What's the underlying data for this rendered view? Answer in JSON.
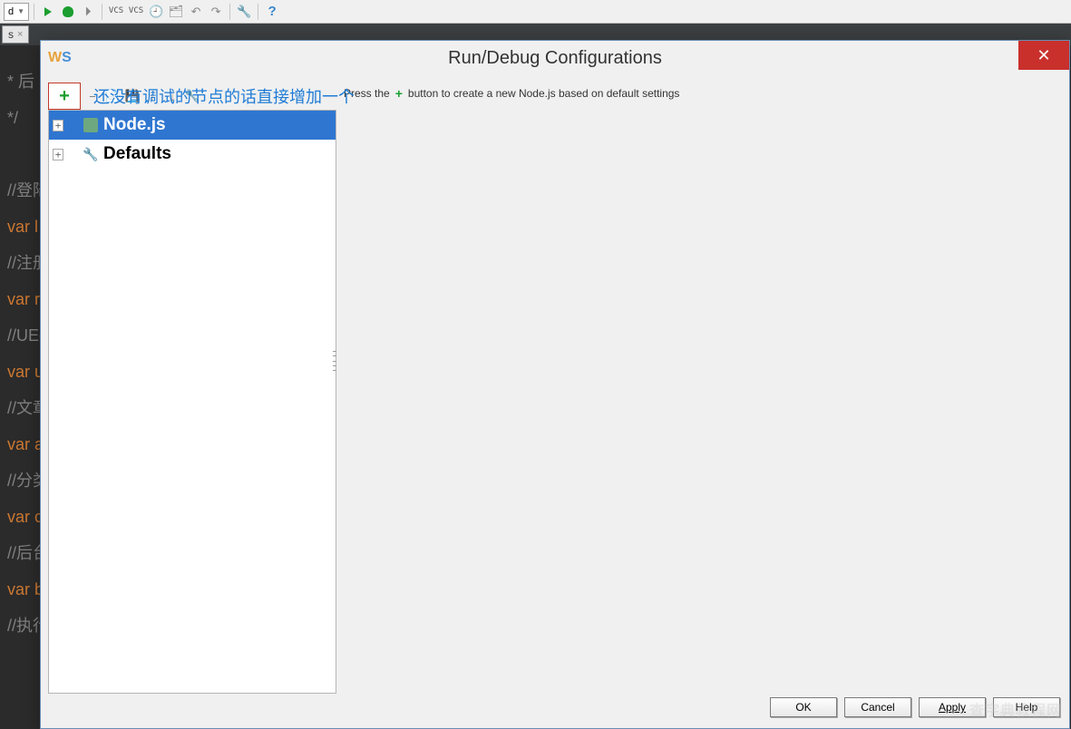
{
  "toolbar": {
    "run_config_label": "d",
    "vcs_down_label": "VCS",
    "vcs_up_label": "VCS"
  },
  "editor": {
    "tab_label": "s",
    "code_lines": {
      "l1": "* 后",
      "l2": "*/",
      "l3": "//登陆",
      "l4": "var l",
      "l5": "//注册",
      "l6": "var r",
      "l7": "//UEd",
      "l8": "var u",
      "l9": "//文章",
      "l10": "var a",
      "l11": "//分类",
      "l12": "var c",
      "l13": "//后台",
      "l14": "var b",
      "l15": "//执行"
    }
  },
  "dialog": {
    "title": "Run/Debug Configurations",
    "annotation": "还没有调试的节点的话直接增加一个",
    "tree": {
      "item0": {
        "label": "Node.js"
      },
      "item1": {
        "label": "Defaults"
      }
    },
    "hint": {
      "before": "Press the",
      "after": "button to create a new Node.js based on default settings"
    },
    "buttons": {
      "ok": "OK",
      "cancel": "Cancel",
      "apply": "Apply",
      "help": "Help"
    }
  },
  "watermark": "查字典教程网"
}
